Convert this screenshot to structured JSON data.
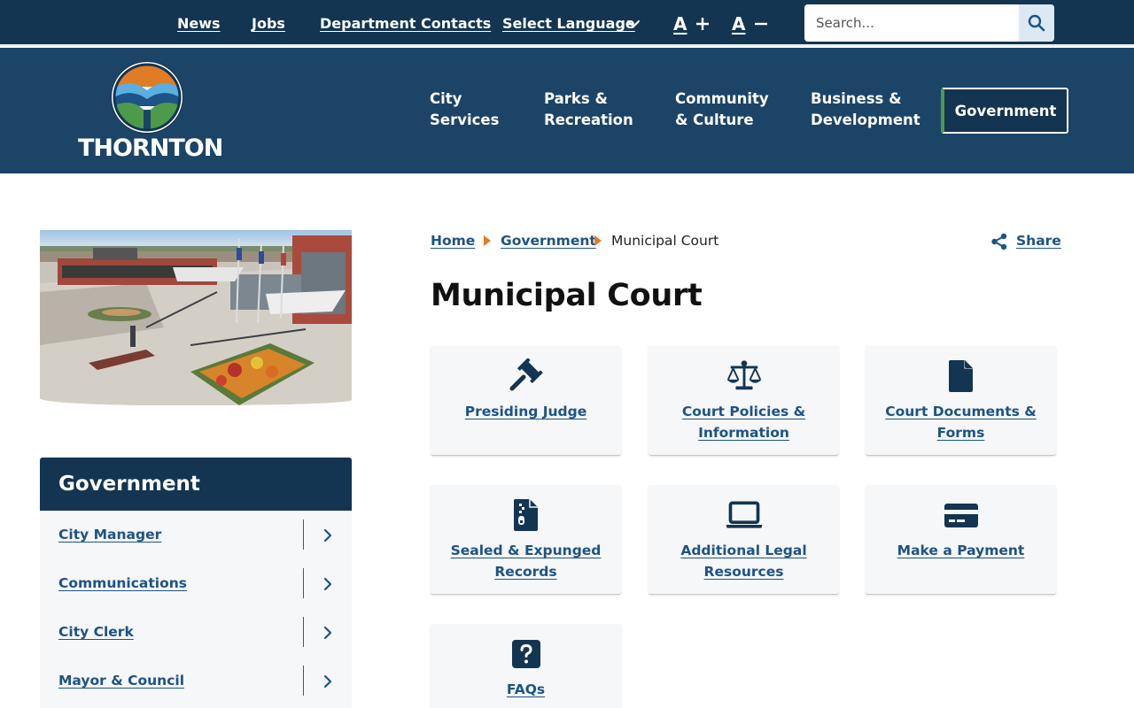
{
  "utility": {
    "links": [
      "News",
      "Jobs",
      "Department Contacts"
    ],
    "language_label": "Select Language",
    "font_increase": "A",
    "font_decrease": "A",
    "search_placeholder": "Search..."
  },
  "header": {
    "logo_text": "THORNTON",
    "nav": [
      {
        "line1": "City",
        "line2": "Services"
      },
      {
        "line1": "Parks &",
        "line2": "Recreation"
      },
      {
        "line1": "Community",
        "line2": "& Culture"
      },
      {
        "line1": "Business &",
        "line2": "Development"
      }
    ],
    "active_nav": "Government"
  },
  "sidebar": {
    "heading": "Government",
    "items": [
      "City Manager",
      "Communications",
      "City Clerk",
      "Mayor & Council"
    ]
  },
  "breadcrumb": {
    "links": [
      "Home",
      "Government"
    ],
    "current": "Municipal Court"
  },
  "share_label": "Share",
  "page_title": "Municipal Court",
  "cards": [
    {
      "icon": "gavel-icon",
      "label": "Presiding Judge"
    },
    {
      "icon": "scales-icon",
      "label": "Court Policies & Information"
    },
    {
      "icon": "document-icon",
      "label": "Court Documents & Forms"
    },
    {
      "icon": "sealed-file-icon",
      "label": "Sealed & Expunged Records"
    },
    {
      "icon": "laptop-icon",
      "label": "Additional Legal Resources"
    },
    {
      "icon": "credit-card-icon",
      "label": "Make a Payment"
    },
    {
      "icon": "question-icon",
      "label": "FAQs"
    }
  ],
  "colors": {
    "utility_bar": "#133552",
    "header": "#1c4467",
    "link": "#1d5386",
    "accent_orange": "#e07b26",
    "accent_green": "#4d9a4a"
  }
}
